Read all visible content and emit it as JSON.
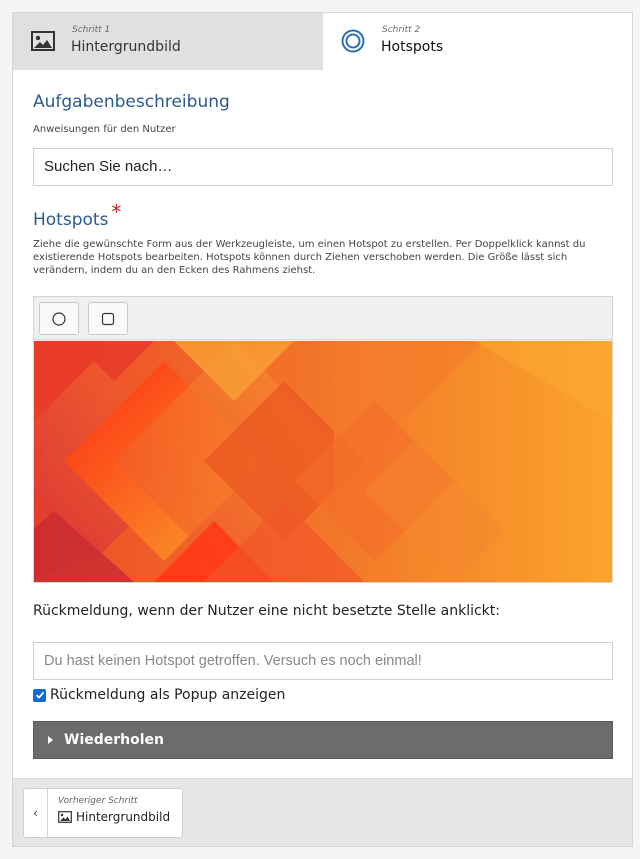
{
  "steps": [
    {
      "small": "Schritt 1",
      "label": "Hintergrundbild",
      "icon": "image-icon"
    },
    {
      "small": "Schritt 2",
      "label": "Hotspots",
      "icon": "target-circle-icon"
    }
  ],
  "task": {
    "heading": "Aufgabenbeschreibung",
    "description": "Anweisungen für den Nutzer",
    "value": "Suchen Sie nach…"
  },
  "hotspots": {
    "heading": "Hotspots",
    "required_mark": "*",
    "description": "Ziehe die gewünschte Form aus der Werkzeugleiste, um einen Hotspot zu erstellen. Per Doppelklick kannst du existierende Hotspots bearbeiten. Hotspots können durch Ziehen verschoben werden. Die Größe lässt sich verändern, indem du an den Ecken des Rahmens ziehst.",
    "tools": [
      "circle-tool",
      "rectangle-tool"
    ]
  },
  "feedback": {
    "label": "Rückmeldung, wenn der Nutzer eine nicht besetzte Stelle anklickt:",
    "placeholder": "Du hast keinen Hotspot getroffen. Versuch es noch einmal!"
  },
  "popup": {
    "label": "Rückmeldung als Popup anzeigen",
    "checked": true
  },
  "repeat": {
    "label": "Wiederholen"
  },
  "footer": {
    "prev_small": "Vorheriger Schritt",
    "prev_label": "Hintergrundbild"
  },
  "colors": {
    "heading_blue": "#2a5a8e",
    "checkbox_blue": "#0f6cd8",
    "repeat_bar": "#6d6b6b",
    "required": "#c62828"
  }
}
